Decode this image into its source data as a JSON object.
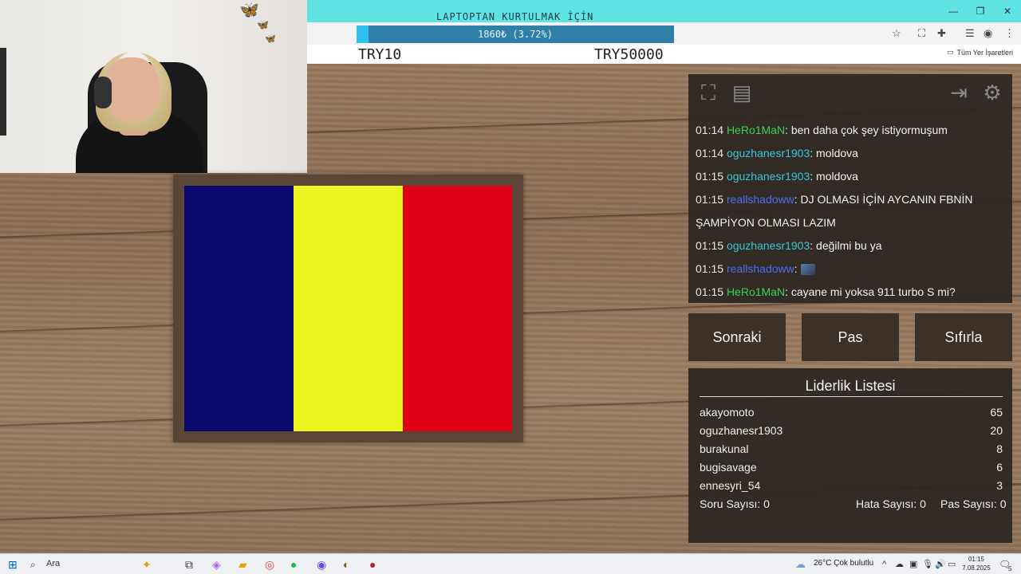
{
  "browser": {
    "goal_title": "LAPTOPTAN KURTULMAK İÇİN",
    "progress_text": "1860₺ (3.72%)",
    "progress_fraction": 0.0372,
    "goal_min": "TRY10",
    "goal_max": "TRY50000",
    "bookmarks_label": "Tüm Yer İşaretleri"
  },
  "flag": {
    "colors": [
      "#0d0a6e",
      "#ecf51f",
      "#e00015"
    ]
  },
  "chat": {
    "messages": [
      {
        "time": "01:14",
        "user": "HeRo1MaN",
        "color": "green",
        "text": ": ben daha çok şey istiyormuşum"
      },
      {
        "time": "01:14",
        "user": "oguzhanesr1903",
        "color": "teal",
        "text": ": moldova"
      },
      {
        "time": "01:15",
        "user": "oguzhanesr1903",
        "color": "teal",
        "text": ": moldova"
      },
      {
        "time": "01:15",
        "user": "reallshadoww",
        "color": "blue",
        "text": ": DJ OLMASI İÇİN AYCANIN FBNİN"
      },
      {
        "time": "",
        "user": "",
        "color": "",
        "text": "ŞAMPİYON OLMASI LAZIM"
      },
      {
        "time": "01:15",
        "user": "oguzhanesr1903",
        "color": "teal",
        "text": ": değilmi bu ya"
      },
      {
        "time": "01:15",
        "user": "reallshadoww",
        "color": "blue",
        "text": ":",
        "emote": true
      },
      {
        "time": "01:15",
        "user": "HeRo1MaN",
        "color": "green",
        "text": ": cayane mi yoksa 911 turbo S mi?"
      }
    ]
  },
  "actions": {
    "next": "Sonraki",
    "pass": "Pas",
    "reset": "Sıfırla"
  },
  "leaderboard": {
    "title": "Liderlik Listesi",
    "rows": [
      {
        "name": "akayomoto",
        "score": "65"
      },
      {
        "name": "oguzhanesr1903",
        "score": "20"
      },
      {
        "name": "burakunal",
        "score": "8"
      },
      {
        "name": "bugisavage",
        "score": "6"
      },
      {
        "name": "ennesyri_54",
        "score": "3"
      }
    ],
    "question_count": "Soru Sayısı: 0",
    "error_count": "Hata Sayısı: 0",
    "pass_count": "Pas Sayısı: 0"
  },
  "taskbar": {
    "search": "Ara",
    "weather": "26°C  Çok bulutlu",
    "time": "01:15",
    "date": "7.08.2025",
    "notifications": "5"
  },
  "icons": {
    "fullscreen": "fullscreen-icon",
    "notes": "notes-icon",
    "exit": "exit-icon",
    "settings": "gear-icon"
  }
}
